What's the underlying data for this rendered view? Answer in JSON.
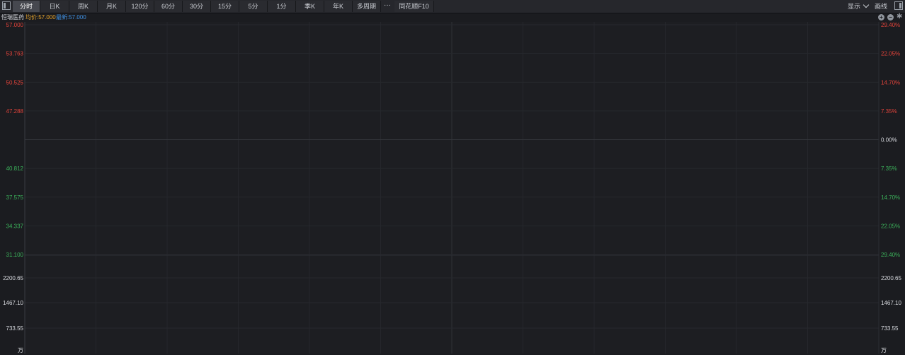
{
  "toolbar": {
    "tabs": [
      {
        "label": "分时",
        "active": true
      },
      {
        "label": "日K"
      },
      {
        "label": "周K"
      },
      {
        "label": "月K"
      },
      {
        "label": "120分"
      },
      {
        "label": "60分"
      },
      {
        "label": "30分"
      },
      {
        "label": "15分"
      },
      {
        "label": "5分"
      },
      {
        "label": "1分"
      },
      {
        "label": "季K"
      },
      {
        "label": "年K"
      },
      {
        "label": "多周期"
      }
    ],
    "more_label": "···",
    "f10_label": "同花顺F10",
    "display_label": "显示",
    "draw_label": "画线"
  },
  "info": {
    "stock_name": "恒瑞医药",
    "avg_price": "均价:57.000",
    "latest": "最新:57.000"
  },
  "colors": {
    "up": "#e0433a",
    "down": "#3bb15a",
    "neutral": "#d8dadf",
    "avg": "#e3a22b",
    "latest": "#3f8fe0"
  },
  "chart_data": {
    "type": "line",
    "price_axis_left": [
      "57.000",
      "53.763",
      "50.525",
      "47.288",
      "",
      "40.812",
      "37.575",
      "34.337",
      "31.100"
    ],
    "price_axis_right": [
      "29.40%",
      "22.05%",
      "14.70%",
      "7.35%",
      "0.00%",
      "7.35%",
      "14.70%",
      "22.05%",
      "29.40%"
    ],
    "price_axis_tone": [
      "up",
      "up",
      "up",
      "up",
      "neutral",
      "down",
      "down",
      "down",
      "down"
    ],
    "volume_axis_left": [
      "2200.65",
      "1467.10",
      "733.55"
    ],
    "volume_axis_right": [
      "2200.65",
      "1467.10",
      "733.55"
    ],
    "volume_unit": "万",
    "series": []
  }
}
